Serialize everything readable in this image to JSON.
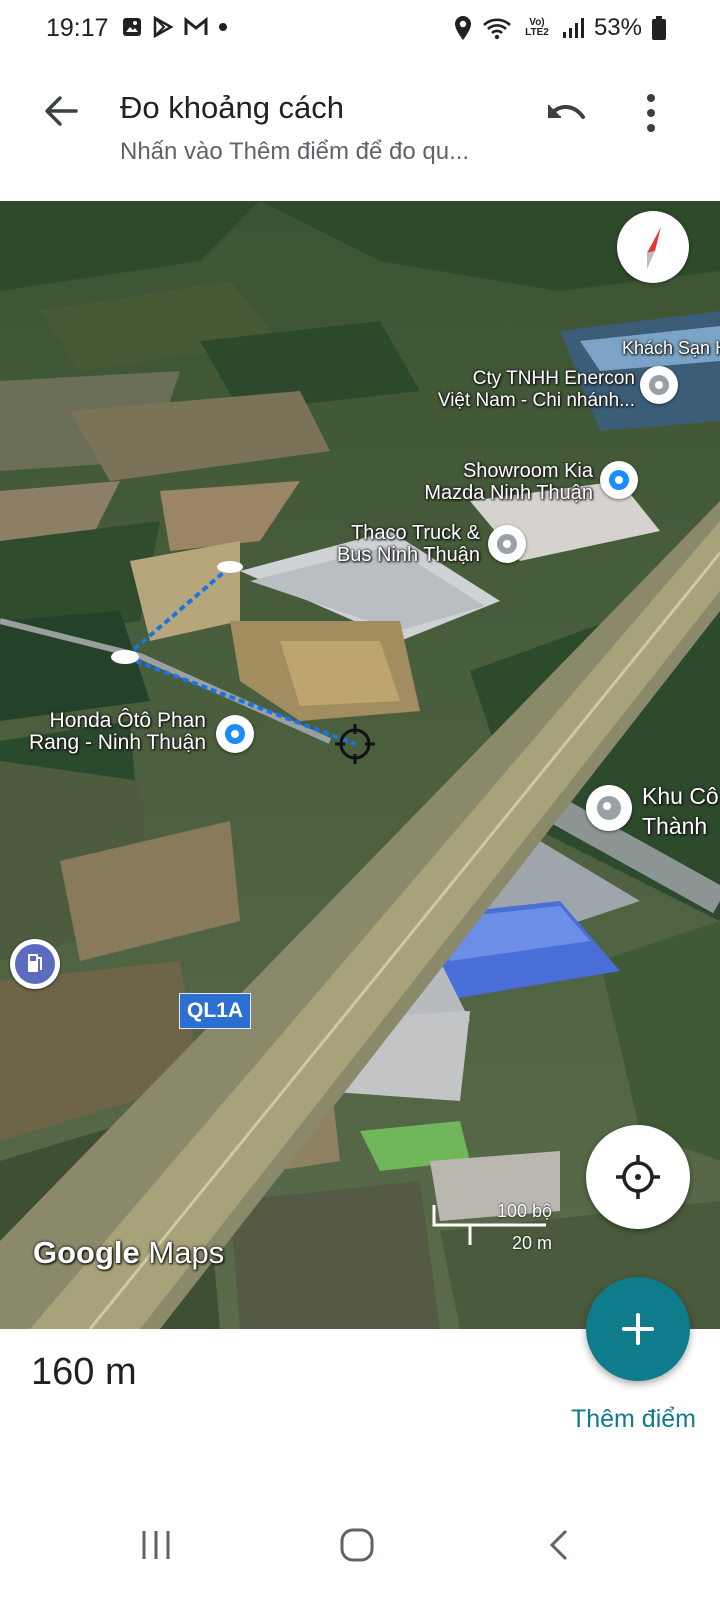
{
  "status_bar": {
    "time": "19:17",
    "network_label": "Vo) LTE2",
    "battery": "53%"
  },
  "app_bar": {
    "title": "Đo khoảng cách",
    "subtitle": "Nhấn vào Thêm điểm để đo qu..."
  },
  "map": {
    "places": [
      {
        "name": "Khách Sạn H"
      },
      {
        "name": "Cty TNHH Enercon",
        "name2": "Việt Nam - Chi nhánh..."
      },
      {
        "name": "Showroom Kia",
        "name2": "Mazda Ninh Thuận"
      },
      {
        "name": "Thaco Truck &",
        "name2": "Bus Ninh Thuận"
      },
      {
        "name": "Honda Ôtô Phan",
        "name2": "Rang - Ninh Thuận"
      },
      {
        "name": "Khu Cô",
        "name2": "Thành"
      }
    ],
    "road_badge": "QL1A",
    "scale_top": "100 bộ",
    "scale_bottom": "20 m",
    "watermark_google": "Google",
    "watermark_maps": "Maps",
    "measure_line_color": "#1a73e8"
  },
  "result": {
    "distance": "160 m",
    "add_point_label": "Thêm điểm"
  },
  "colors": {
    "accent": "#0f7c8c",
    "link": "#117a8b"
  }
}
